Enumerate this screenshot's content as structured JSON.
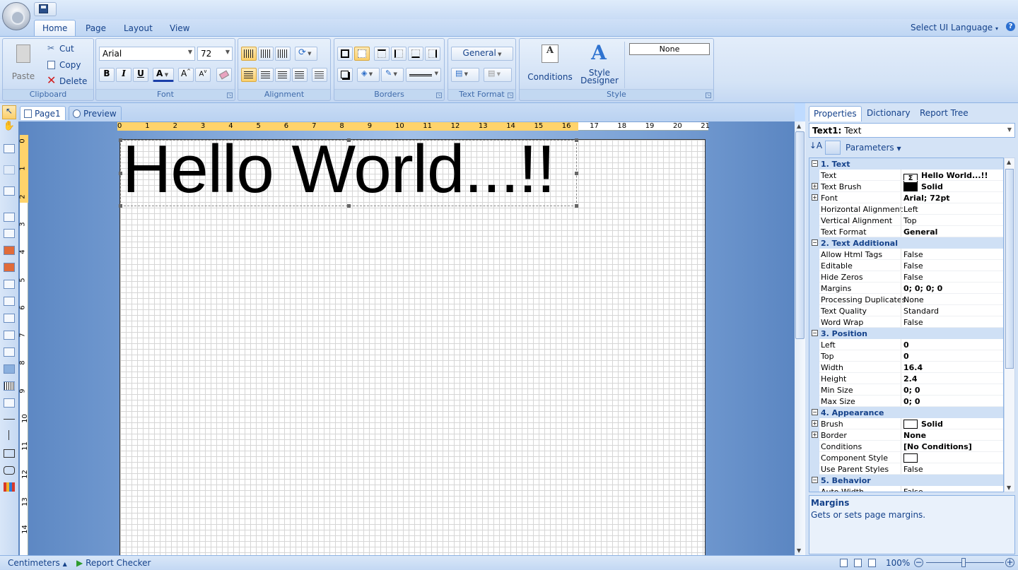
{
  "ribbon_tabs": [
    "Home",
    "Page",
    "Layout",
    "View"
  ],
  "select_ui_language": "Select UI Language",
  "clipboard": {
    "paste": "Paste",
    "cut": "Cut",
    "copy": "Copy",
    "delete": "Delete",
    "label": "Clipboard"
  },
  "font": {
    "family": "Arial",
    "size": "72",
    "label": "Font"
  },
  "alignment": {
    "label": "Alignment"
  },
  "borders": {
    "label": "Borders"
  },
  "text_format": {
    "value": "General",
    "label": "Text Format"
  },
  "style": {
    "conditions": "Conditions",
    "designer_line1": "Style",
    "designer_line2": "Designer",
    "style_value": "None",
    "label": "Style"
  },
  "doc_tabs": [
    "Page1",
    "Preview"
  ],
  "ruler_top": [
    "0",
    "1",
    "2",
    "3",
    "4",
    "5",
    "6",
    "7",
    "8",
    "9",
    "10",
    "11",
    "12",
    "13",
    "14",
    "15",
    "16",
    "17",
    "18",
    "19",
    "20",
    "21"
  ],
  "ruler_left": [
    "0",
    "1",
    "2",
    "3",
    "4",
    "5",
    "6",
    "7",
    "8",
    "9",
    "10",
    "11",
    "12",
    "13",
    "14"
  ],
  "canvas_text": "Hello World...!!",
  "panel_tabs": [
    "Properties",
    "Dictionary",
    "Report Tree"
  ],
  "component_name": "Text1:",
  "component_type": "Text",
  "parameters_label": "Parameters",
  "properties": [
    {
      "cat": "1. Text"
    },
    {
      "name": "Text",
      "value": "Hello World...!!",
      "icon": "sigma",
      "bold": true
    },
    {
      "name": "Text Brush",
      "value": "Solid",
      "swatch": "#000000",
      "bold": true,
      "exp": true
    },
    {
      "name": "Font",
      "value": "Arial; 72pt",
      "bold": true,
      "exp": true
    },
    {
      "name": "Horizontal Alignment",
      "value": "Left"
    },
    {
      "name": "Vertical Alignment",
      "value": "Top"
    },
    {
      "name": "Text Format",
      "value": "General",
      "bold": true
    },
    {
      "cat": "2. Text Additional"
    },
    {
      "name": "Allow Html Tags",
      "value": "False"
    },
    {
      "name": "Editable",
      "value": "False"
    },
    {
      "name": "Hide Zeros",
      "value": "False"
    },
    {
      "name": "Margins",
      "value": "0; 0; 0; 0",
      "bold": true
    },
    {
      "name": "Processing Duplicates",
      "value": "None"
    },
    {
      "name": "Text Quality",
      "value": "Standard"
    },
    {
      "name": "Word Wrap",
      "value": "False"
    },
    {
      "cat": "3. Position"
    },
    {
      "name": "Left",
      "value": "0",
      "bold": true
    },
    {
      "name": "Top",
      "value": "0",
      "bold": true
    },
    {
      "name": "Width",
      "value": "16.4",
      "bold": true
    },
    {
      "name": "Height",
      "value": "2.4",
      "bold": true
    },
    {
      "name": "Min Size",
      "value": "0; 0",
      "bold": true
    },
    {
      "name": "Max Size",
      "value": "0; 0",
      "bold": true
    },
    {
      "cat": "4. Appearance"
    },
    {
      "name": "Brush",
      "value": "Solid",
      "swatch": "#ffffff",
      "bold": true,
      "exp": true
    },
    {
      "name": "Border",
      "value": "None",
      "bold": true,
      "exp": true
    },
    {
      "name": "Conditions",
      "value": "[No Conditions]",
      "bold": true
    },
    {
      "name": "Component Style",
      "value": "",
      "swatch": "#ffffff"
    },
    {
      "name": "Use Parent Styles",
      "value": "False"
    },
    {
      "cat": "5. Behavior"
    },
    {
      "name": "Auto Width",
      "value": "False"
    }
  ],
  "description": {
    "title": "Margins",
    "text": "Gets or sets page margins."
  },
  "status": {
    "units": "Centimeters",
    "checker": "Report Checker",
    "zoom": "100%"
  }
}
